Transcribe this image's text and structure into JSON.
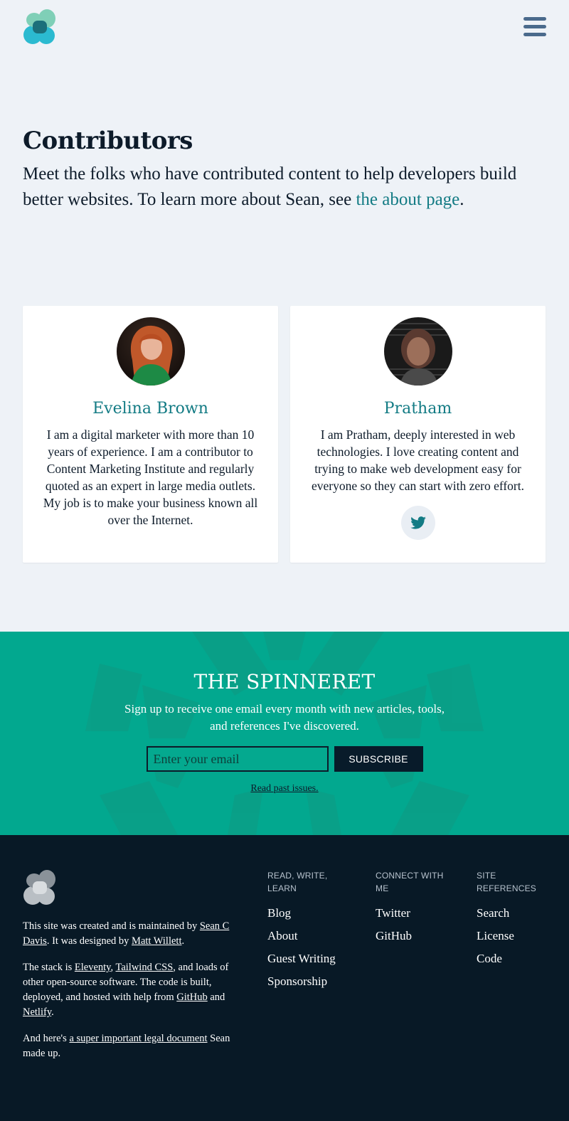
{
  "header": {
    "logo_icon": "site-logo-icon",
    "menu_icon": "hamburger-menu-icon"
  },
  "intro": {
    "title": "Contributors",
    "text_before": "Meet the folks who have contributed content to help developers build better websites. To learn more about Sean, see ",
    "link_text": "the about page",
    "text_after": "."
  },
  "contributors": [
    {
      "name": "Evelina Brown",
      "bio": "I am a digital marketer with more than 10 years of experience. I am a contributor to Content Marketing Institute and regularly quoted as an expert in large media outlets. My job is to make your business known all over the Internet."
    },
    {
      "name": "Pratham",
      "bio": "I am Pratham, deeply interested in web technologies. I love creating content and trying to make web development easy for everyone so they can start with zero effort.",
      "social_icon": "twitter-icon"
    }
  ],
  "newsletter": {
    "title": "THE SPINNERET",
    "description": "Sign up to receive one email every month with new articles, tools, and references I've discovered.",
    "email_placeholder": "Enter your email",
    "subscribe_label": "SUBSCRIBE",
    "past_issues_link": "Read past issues."
  },
  "footer": {
    "about": {
      "p1_a": "This site was created and is maintained by ",
      "p1_link1": "Sean C Davis",
      "p1_b": ". It was designed by ",
      "p1_link2": "Matt Willett",
      "p1_c": ".",
      "p2_a": "The stack is ",
      "p2_link1": "Eleventy",
      "p2_b": ", ",
      "p2_link2": "Tailwind CSS",
      "p2_c": ", and loads of other open-source software. The code is built, deployed, and hosted with help from ",
      "p2_link3": "GitHub",
      "p2_d": " and ",
      "p2_link4": "Netlify",
      "p2_e": ".",
      "p3_a": "And here's ",
      "p3_link": "a super important legal document",
      "p3_b": " Sean made up."
    },
    "columns": [
      {
        "heading": "READ, WRITE, LEARN",
        "links": [
          "Blog",
          "About",
          "Guest Writing",
          "Sponsorship"
        ]
      },
      {
        "heading": "CONNECT WITH ME",
        "links": [
          "Twitter",
          "GitHub"
        ]
      },
      {
        "heading": "SITE REFERENCES",
        "links": [
          "Search",
          "License",
          "Code"
        ]
      }
    ]
  },
  "colors": {
    "page_bg": "#eef2f7",
    "accent_teal": "#137b84",
    "newsletter_bg": "#02a88f",
    "footer_bg": "#081926"
  }
}
